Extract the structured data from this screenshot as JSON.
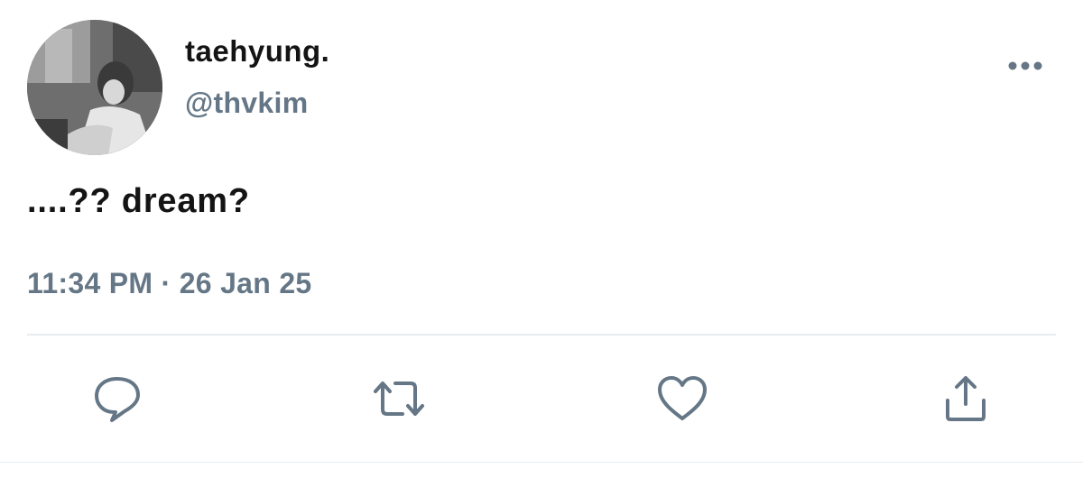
{
  "tweet": {
    "display_name": "taehyung.",
    "handle": "@thvkim",
    "text": "....?? dream?",
    "timestamp": "11:34 PM · 26 Jan 25"
  },
  "header": {
    "more_icon": "more-horizontal-icon"
  },
  "actions": [
    {
      "name": "reply",
      "icon": "reply-icon"
    },
    {
      "name": "retweet",
      "icon": "retweet-icon"
    },
    {
      "name": "like",
      "icon": "heart-icon"
    },
    {
      "name": "share",
      "icon": "share-icon"
    }
  ],
  "colors": {
    "primary_text": "#141414",
    "secondary_text": "#657786",
    "divider": "#e6ecf0"
  }
}
